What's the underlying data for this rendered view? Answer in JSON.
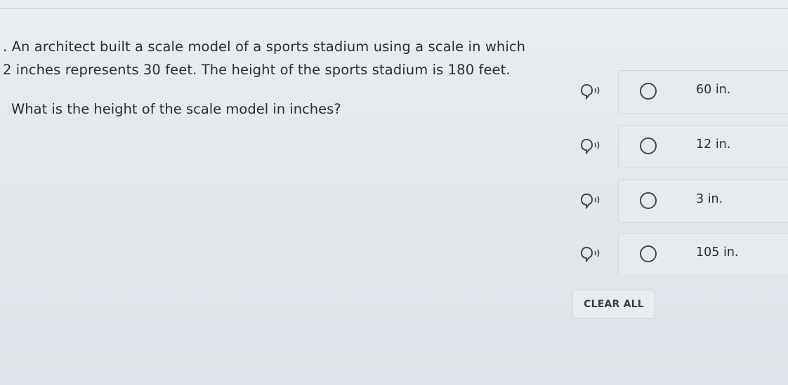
{
  "question": {
    "line1": ". An architect built a scale model of a sports stadium using a scale in which",
    "line2": "2 inches represents 30 feet. The height of the sports stadium is 180 feet.",
    "prompt": "What is the height of the scale model in inches?"
  },
  "choices": [
    {
      "label": "60 in.",
      "icon": "read-aloud-speaker-icon"
    },
    {
      "label": "12 in.",
      "icon": "read-aloud-speaker-icon"
    },
    {
      "label": "3 in.",
      "icon": "read-aloud-speaker-icon"
    },
    {
      "label": "105 in.",
      "icon": "read-aloud-speaker-icon"
    }
  ],
  "clear_all_label": "CLEAR ALL",
  "colors": {
    "text": "#2b2e33",
    "background": "#e3e8ec",
    "border": "#cfd6dc"
  }
}
